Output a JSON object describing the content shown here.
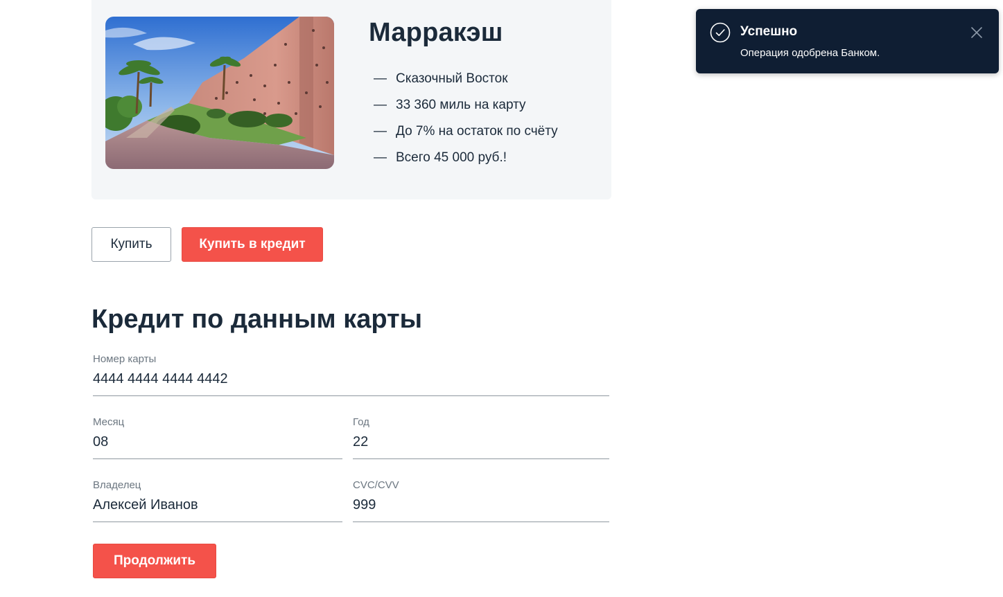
{
  "tour": {
    "title": "Марракэш",
    "features": [
      "Сказочный Восток",
      "33 360 миль на карту",
      "До 7% на остаток по счёту",
      "Всего 45 000 руб.!"
    ],
    "dash": "—"
  },
  "actions": {
    "buy_label": "Купить",
    "buy_credit_label": "Купить в кредит"
  },
  "form": {
    "title": "Кредит по данным карты",
    "card_number": {
      "label": "Номер карты",
      "value": "4444 4444 4444 4442"
    },
    "month": {
      "label": "Месяц",
      "value": "08"
    },
    "year": {
      "label": "Год",
      "value": "22"
    },
    "owner": {
      "label": "Владелец",
      "value": "Алексей Иванов"
    },
    "cvc": {
      "label": "CVC/CVV",
      "value": "999"
    },
    "continue_label": "Продолжить"
  },
  "notification": {
    "title": "Успешно",
    "message": "Операция одобрена Банком.",
    "icon": "check-circle-icon",
    "close_icon": "close-icon"
  },
  "colors": {
    "accent": "#f4524a",
    "toast_bg": "#0f1e33",
    "card_bg": "#f4f6f8",
    "text": "#1b2a3a"
  }
}
